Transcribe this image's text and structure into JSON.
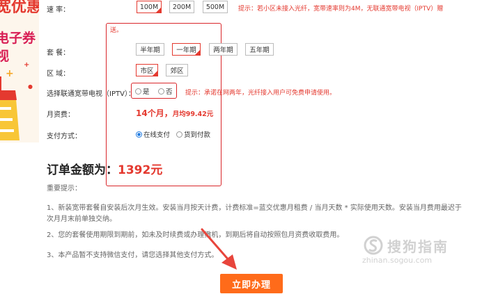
{
  "promo": {
    "line1": "宽优惠",
    "line2": "电子券",
    "line3": "视"
  },
  "speed": {
    "label": "速   率：",
    "options": [
      "100M",
      "200M",
      "500M"
    ],
    "selected": "100M",
    "hint": "提示：若小区未接入光纤，宽带速率则为4M，无联通宽带电视（IPTV）赠",
    "hint_wrap": "送。"
  },
  "package": {
    "label": "套   餐：",
    "options": [
      "半年期",
      "一年期",
      "两年期",
      "五年期"
    ],
    "selected": "一年期"
  },
  "region": {
    "label": "区   域：",
    "options": [
      "市区",
      "郊区"
    ],
    "selected": "市区"
  },
  "iptv": {
    "label": "选择联通宽带电视（IPTV）：",
    "options": [
      "是",
      "否"
    ],
    "hint": "提示：承诺在网两年，光纤接入用户可免费申请使用。"
  },
  "monthly": {
    "label": "月资费：",
    "value": "14个月，",
    "avg": "月均99.42元"
  },
  "payment": {
    "label": "支付方式：",
    "options": [
      "在线支付",
      "货到付款"
    ],
    "selected": "在线支付"
  },
  "order": {
    "label": "订单金额为：",
    "amount": "1392元"
  },
  "notes": {
    "title": "重要提示：",
    "items": [
      "1、新装宽带套餐自安装后次月生效。安装当月按天计费，计费标准=蓝交优惠月租费 / 当月天数 * 实际使用天数。安装当月费用最迟于次月月末前单独交纳。",
      "2、您的套餐使用期限到期前，如未及时续费或办理撤机，到期后将自动按照包月资费收取费用。",
      "3、本产品暂不支持微信支付，请您选择其他支付方式。"
    ]
  },
  "submit_label": "立即办理",
  "watermark": {
    "brand": "搜狗指南",
    "url": "zhinan.sogou.com"
  },
  "colors": {
    "accent": "#e4392f",
    "submit": "#ff6b1a",
    "highlight_box": "#d9262a",
    "arrow": "#e8453c"
  }
}
